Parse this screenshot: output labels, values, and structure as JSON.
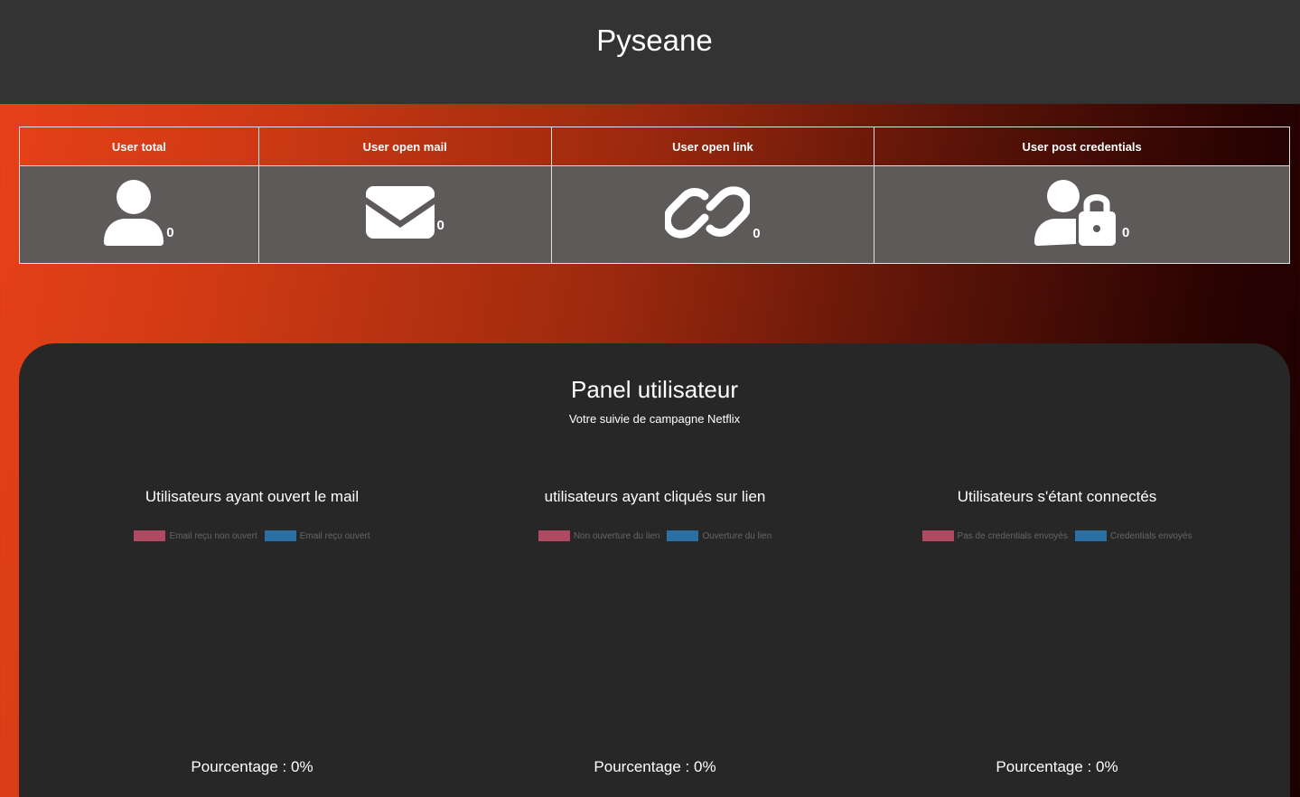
{
  "app": {
    "title": "Pyseane"
  },
  "stats": [
    {
      "label": "User total",
      "icon": "user-icon",
      "count": "0"
    },
    {
      "label": "User open mail",
      "icon": "envelope-icon",
      "count": "0"
    },
    {
      "label": "User open link",
      "icon": "link-icon",
      "count": "0"
    },
    {
      "label": "User post credentials",
      "icon": "user-lock-icon",
      "count": "0"
    }
  ],
  "panel": {
    "title": "Panel utilisateur",
    "subtitle": "Votre suivie de campagne Netflix"
  },
  "colors": {
    "legend_red": "#b04a62",
    "legend_blue": "#2b6fa3",
    "panel_bg": "#272727",
    "header_bg": "#333333"
  },
  "chart_data": [
    {
      "type": "pie",
      "title": "Utilisateurs ayant ouvert le mail",
      "series": [
        {
          "name": "Email reçu non ouvert",
          "values": [
            0
          ]
        },
        {
          "name": "Email reçu ouvert",
          "values": [
            0
          ]
        }
      ],
      "legend_position": "top",
      "percentage_label": "Pourcentage : 0%"
    },
    {
      "type": "pie",
      "title": "utilisateurs ayant cliqués sur lien",
      "series": [
        {
          "name": "Non ouverture du lien",
          "values": [
            0
          ]
        },
        {
          "name": "Ouverture du lien",
          "values": [
            0
          ]
        }
      ],
      "legend_position": "top",
      "percentage_label": "Pourcentage : 0%"
    },
    {
      "type": "pie",
      "title": "Utilisateurs s'étant connectés",
      "series": [
        {
          "name": "Pas de credentials envoyés",
          "values": [
            0
          ]
        },
        {
          "name": "Credentials envoyés",
          "values": [
            0
          ]
        }
      ],
      "legend_position": "top",
      "percentage_label": "Pourcentage : 0%"
    }
  ]
}
